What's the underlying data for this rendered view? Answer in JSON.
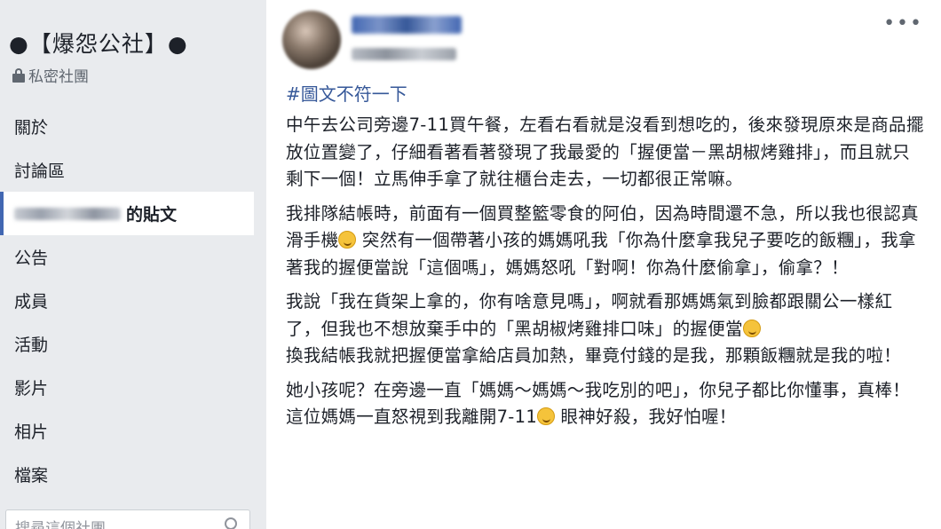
{
  "sidebar": {
    "group_name": "●【爆怨公社】●",
    "privacy_label": "私密社團",
    "items": [
      {
        "label": "關於"
      },
      {
        "label": "討論區"
      },
      {
        "label": "的貼文"
      },
      {
        "label": "公告"
      },
      {
        "label": "成員"
      },
      {
        "label": "活動"
      },
      {
        "label": "影片"
      },
      {
        "label": "相片"
      },
      {
        "label": "檔案"
      }
    ],
    "search_placeholder": "搜尋這個社團"
  },
  "post": {
    "hashtag": "#圖文不符一下",
    "paragraphs": [
      {
        "text": "中午去公司旁邊7-11買午餐，左看右看就是沒看到想吃的，後來發現原來是商品擺放位置變了，仔細看著看著發現了我最愛的「握便當－黑胡椒烤雞排」，而且就只剩下一個！立馬伸手拿了就往櫃台走去，一切都很正常嘛。"
      },
      {
        "a": "我排隊結帳時，前面有一個買整籃零食的阿伯，因為時間還不急，所以我也很認真滑手機",
        "b": " 突然有一個帶著小孩的媽媽吼我「你為什麼拿我兒子要吃的飯糰」，我拿著我的握便當說「這個嗎」，媽媽怒吼「對啊！你為什麼偷拿」，偷拿？！"
      },
      {
        "a": "我說「我在貨架上拿的，你有啥意見嗎」，啊就看那媽媽氣到臉都跟關公一樣紅了，但我也不想放棄手中的「黑胡椒烤雞排口味」的握便當",
        "b": "換我結帳我就把握便當拿給店員加熱，畢竟付錢的是我，那顆飯糰就是我的啦！"
      },
      {
        "a": "她小孩呢？在旁邊一直「媽媽～媽媽～我吃別的吧」，你兒子都比你懂事，真棒！這位媽媽一直怒視到我離開7-11",
        "b": " 眼神好殺，我好怕喔！"
      }
    ],
    "more_icon": "•••"
  }
}
